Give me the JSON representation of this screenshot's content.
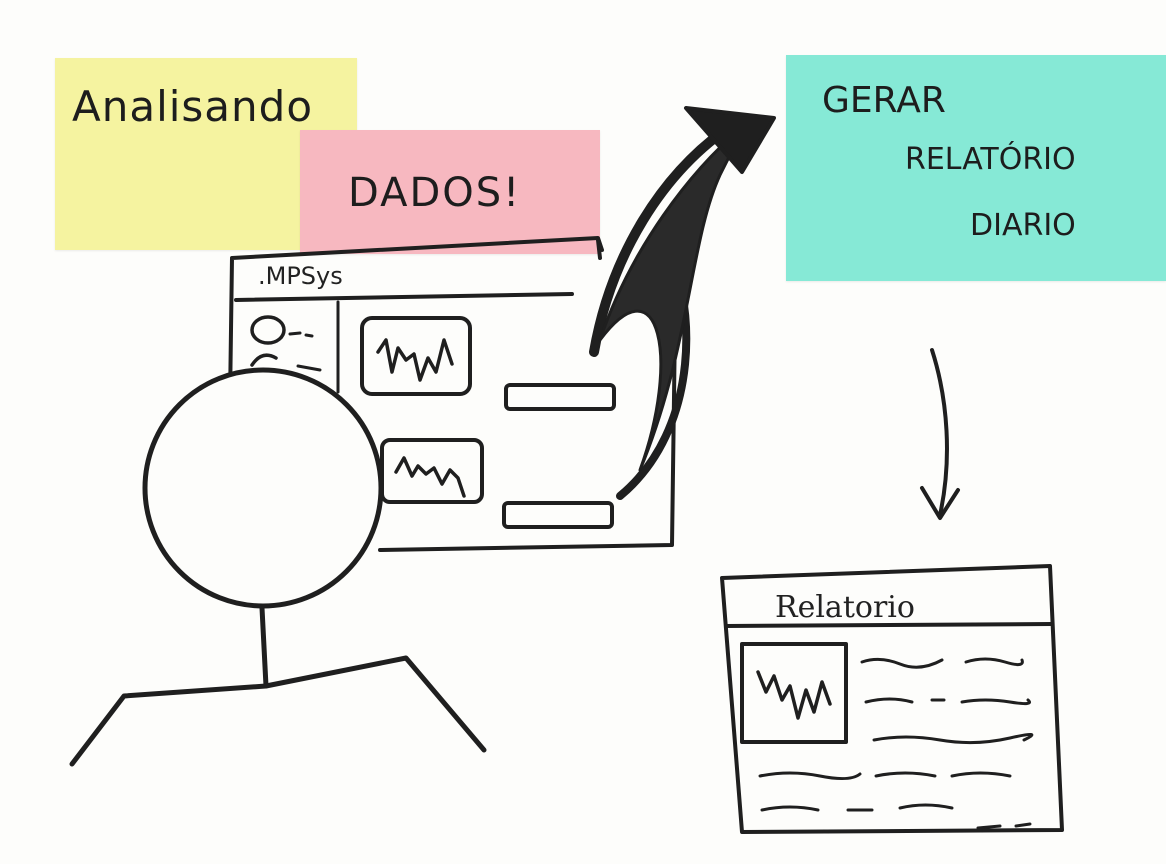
{
  "sticky_notes": {
    "yellow": {
      "text": "Analisando",
      "color": "#f5f3a0"
    },
    "pink": {
      "text": "DADOS!",
      "color": "#f7b8c0"
    },
    "teal": {
      "lines": [
        "GERAR",
        "RELATÓRIO",
        "DIARIO"
      ],
      "color": "#86e9d6"
    }
  },
  "app_window": {
    "title": ".MPSys"
  },
  "report_window": {
    "title": "Relatorio"
  },
  "colors": {
    "ink": "#1f1f1f",
    "paper": "#fdfdfb"
  }
}
